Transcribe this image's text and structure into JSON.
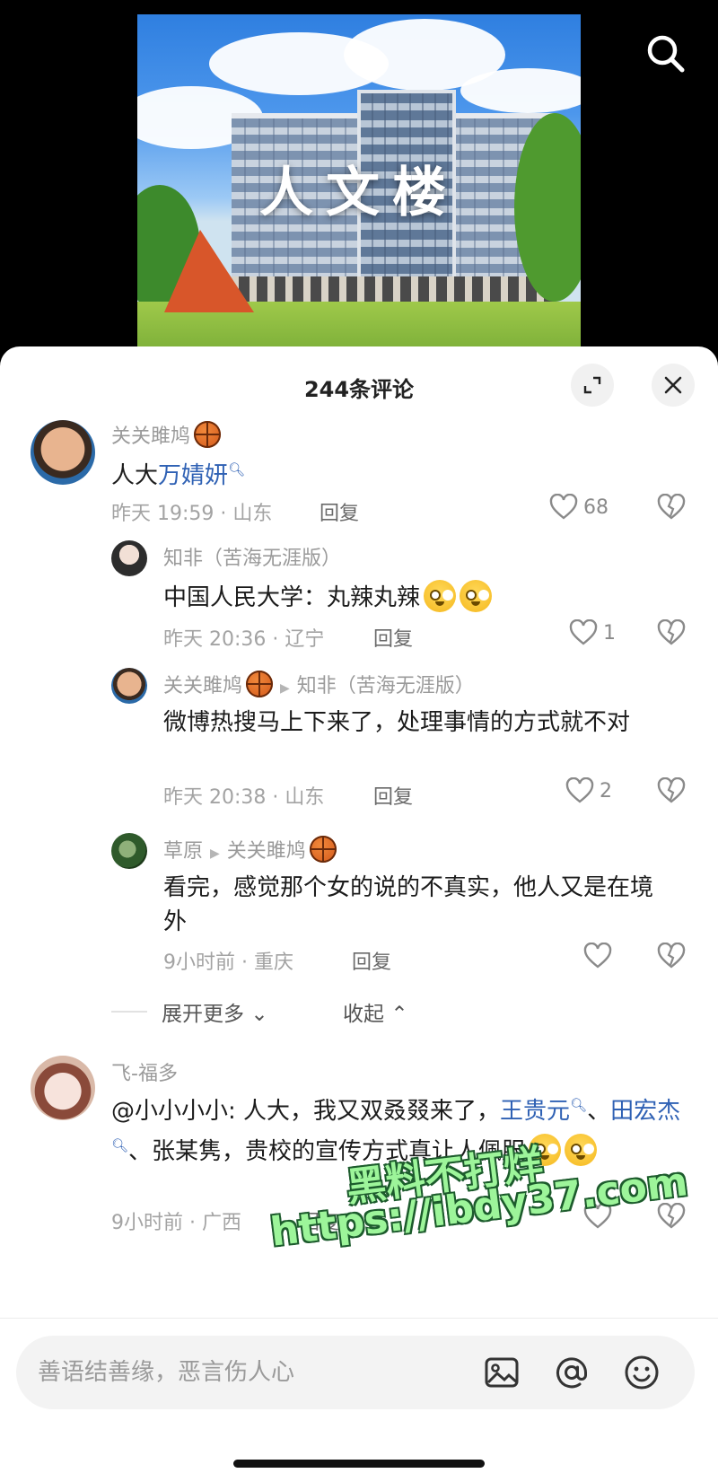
{
  "video": {
    "photo_title": "人文楼"
  },
  "header": {
    "title": "244条评论"
  },
  "comments": [
    {
      "user": "关关雎鸠",
      "text_plain": "人大",
      "text_link": "万婧妍",
      "time_location": "昨天 19:59 · 山东",
      "reply_label": "回复",
      "likes": "68",
      "replies": [
        {
          "user": "知非（苦海无涯版）",
          "text": "中国人民大学：丸辣丸辣",
          "time_location": "昨天 20:36 · 辽宁",
          "reply_label": "回复",
          "likes": "1"
        },
        {
          "user": "关关雎鸠",
          "reply_to": "知非（苦海无涯版）",
          "text": "微博热搜马上下来了，处理事情的方式就不对",
          "time_location": "昨天 20:38 · 山东",
          "reply_label": "回复",
          "likes": "2"
        },
        {
          "user": "草原",
          "reply_to": "关关雎鸠",
          "text": "看完，感觉那个女的说的不真实，他人又是在境外",
          "time_location": "9小时前 · 重庆",
          "reply_label": "回复",
          "likes": ""
        }
      ],
      "expand_more": "展开更多",
      "collapse": "收起"
    },
    {
      "user": "飞-福多",
      "text_part1": "@小小小小: 人大，我又双叒叕来了，",
      "link1": "王贵元",
      "sep": "、",
      "link2": "田宏杰",
      "text_part2": "、张某隽，贵校的宣传方式真让人佩服",
      "time_location": "9小时前 · 广西",
      "reply_label": "回复"
    }
  ],
  "watermark": {
    "line1": "黑料不打烊",
    "line2": "https://ibdy37.com"
  },
  "input": {
    "placeholder": "善语结善缘，恶言伤人心"
  },
  "colors": {
    "link": "#2f61b4",
    "watermark": "#9df59a"
  },
  "icons": [
    "search-icon",
    "expand-icon",
    "close-icon",
    "heart-icon",
    "broken-heart-icon",
    "basketball-emoji",
    "image-icon",
    "at-icon",
    "smile-icon"
  ]
}
